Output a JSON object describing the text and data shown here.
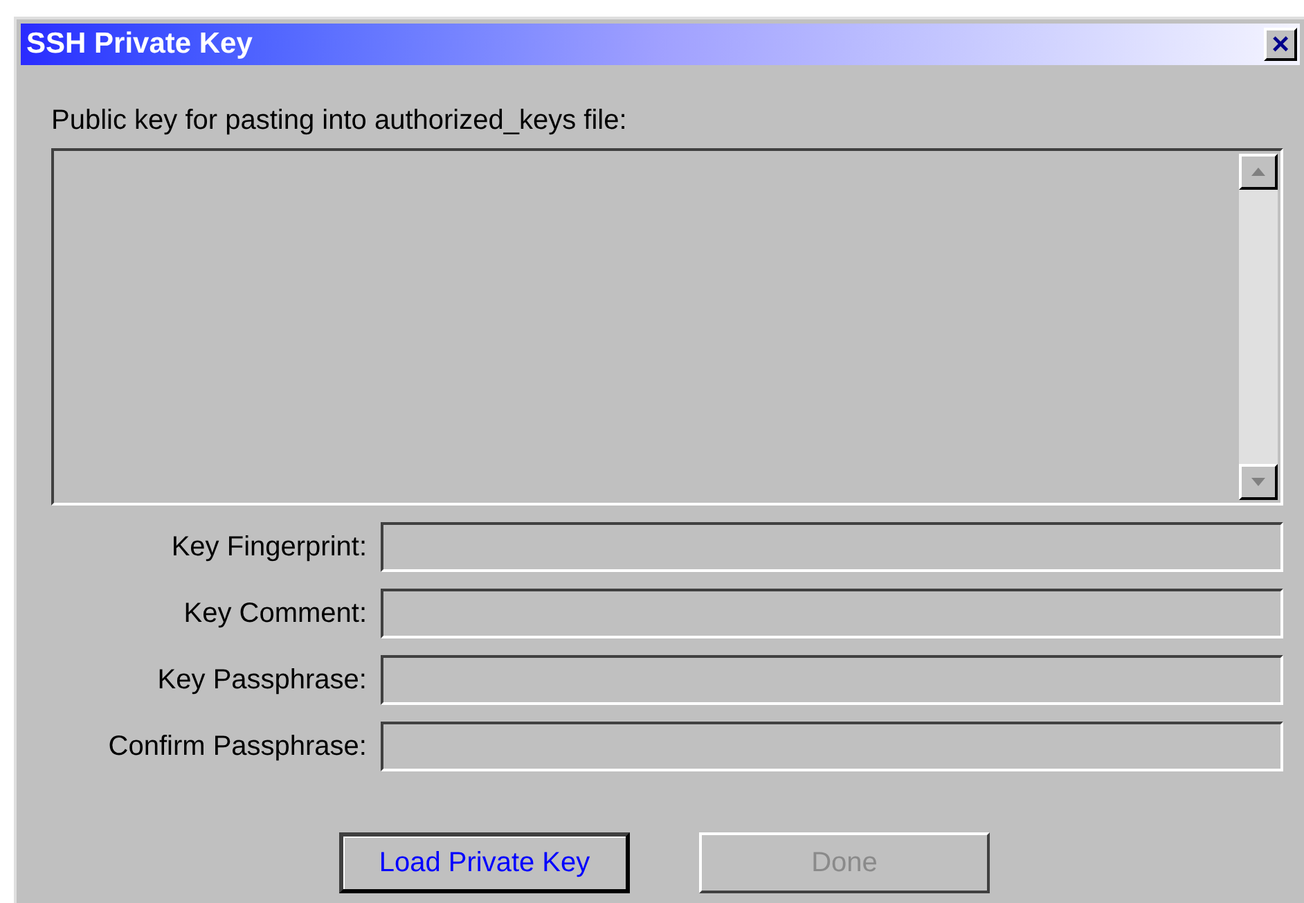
{
  "window": {
    "title": "SSH Private Key",
    "close": "×"
  },
  "public_key": {
    "label": "Public key for pasting into authorized_keys file:"
  },
  "fields": [
    {
      "label": "Key Fingerprint:"
    },
    {
      "label": "Key Comment:"
    },
    {
      "label": "Key Passphrase:"
    },
    {
      "label": "Confirm Passphrase:"
    }
  ],
  "buttons": [
    {
      "label": "Load Private Key",
      "default": true,
      "disabled": false
    },
    {
      "label": "Done",
      "default": false,
      "disabled": true
    }
  ]
}
